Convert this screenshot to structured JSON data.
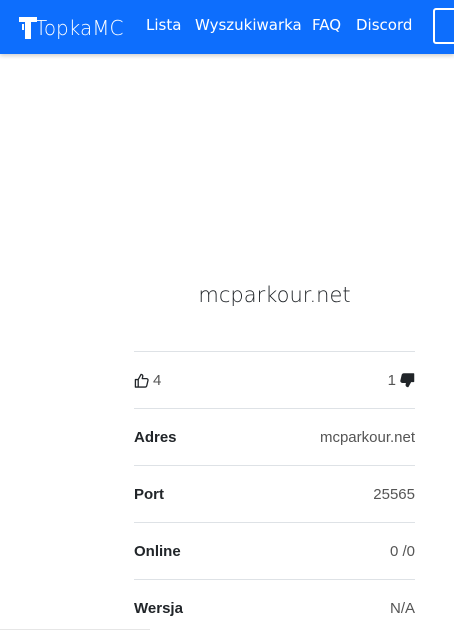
{
  "navbar": {
    "brand": "TopkaMC",
    "links": [
      "Lista",
      "Wyszukiwarka",
      "FAQ",
      "Discord"
    ]
  },
  "server": {
    "name": "mcparkour.net",
    "likes": "4",
    "dislikes": "1",
    "rows": [
      {
        "label": "Adres",
        "value": "mcparkour.net"
      },
      {
        "label": "Port",
        "value": "25565"
      },
      {
        "label": "Online",
        "value": "0 /0"
      },
      {
        "label": "Wersja",
        "value": "N/A"
      }
    ]
  },
  "colors": {
    "navbar": "#0d6efd",
    "text": "#212529",
    "muted": "#555555"
  },
  "icons": [
    "thumbs-up-icon",
    "thumbs-down-icon"
  ]
}
